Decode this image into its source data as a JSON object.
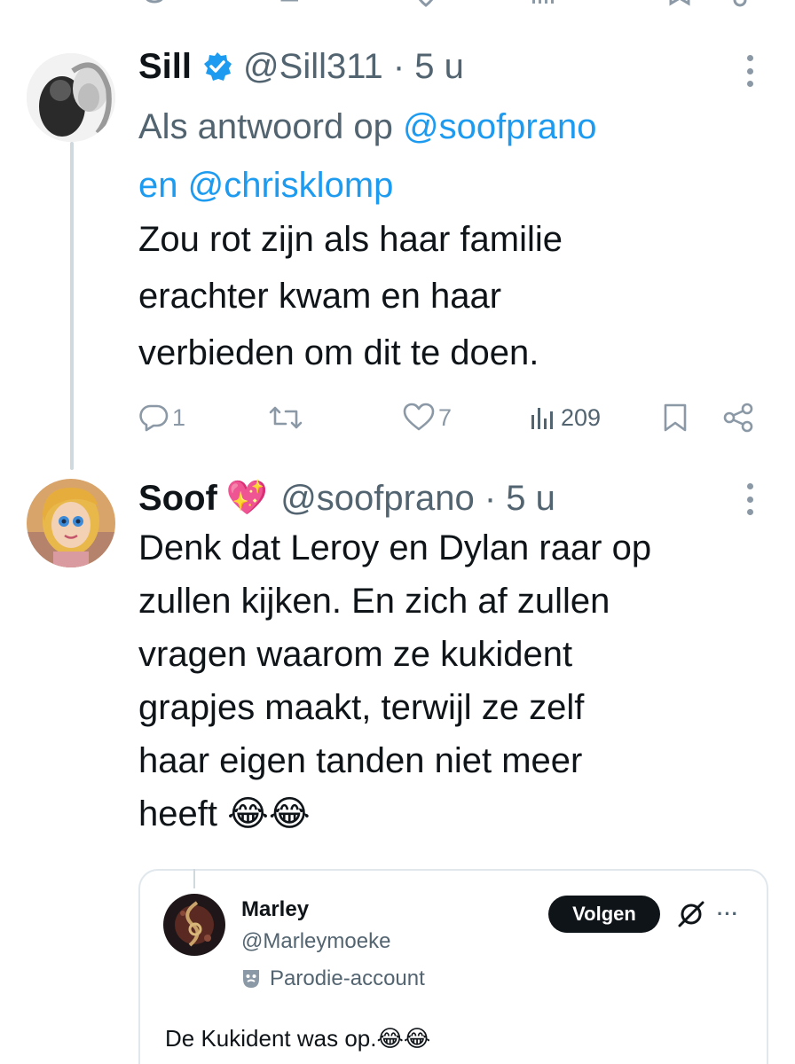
{
  "tweet1": {
    "name": "Sill",
    "handle": "@Sill311 · 5 u",
    "reply_prefix": "Als antwoord op",
    "reply_mention1": "@soofprano",
    "reply_joiner": "en",
    "reply_mention2": "@chrisklomp",
    "text": "Zou rot zijn als haar familie\nerachter kwam en haar\nverbieden om dit te doen.",
    "actions": {
      "replies": "1",
      "reposts": "",
      "likes": "7",
      "views": "209"
    },
    "verified_badge_color": "#1d9bf0",
    "icons": [
      "reply-icon",
      "repost-icon",
      "like-icon",
      "views-icon",
      "bookmark-icon",
      "share-icon"
    ]
  },
  "tweet2": {
    "name": "Soof",
    "name_emoji": "💖",
    "handle": "@soofprano · 5 u",
    "text": "Denk dat Leroy en Dylan raar op\nzullen kijken. En zich af zullen\nvragen waarom ze kukident\ngrapjes maakt, terwijl ze zelf\nhaar eigen tanden niet meer\nheeft 😂😂"
  },
  "quote": {
    "name": "Marley",
    "handle": "@Marleymoeke",
    "parody_label": "Parodie-account",
    "follow_label": "Volgen",
    "more_label": "···",
    "text": "De Kukident was op.😂😂"
  },
  "colors": {
    "accent": "#1d9bf0",
    "text": "#0f1419",
    "secondary": "#536471",
    "icon": "#8b98a5",
    "thread_line": "#cfd9de"
  }
}
